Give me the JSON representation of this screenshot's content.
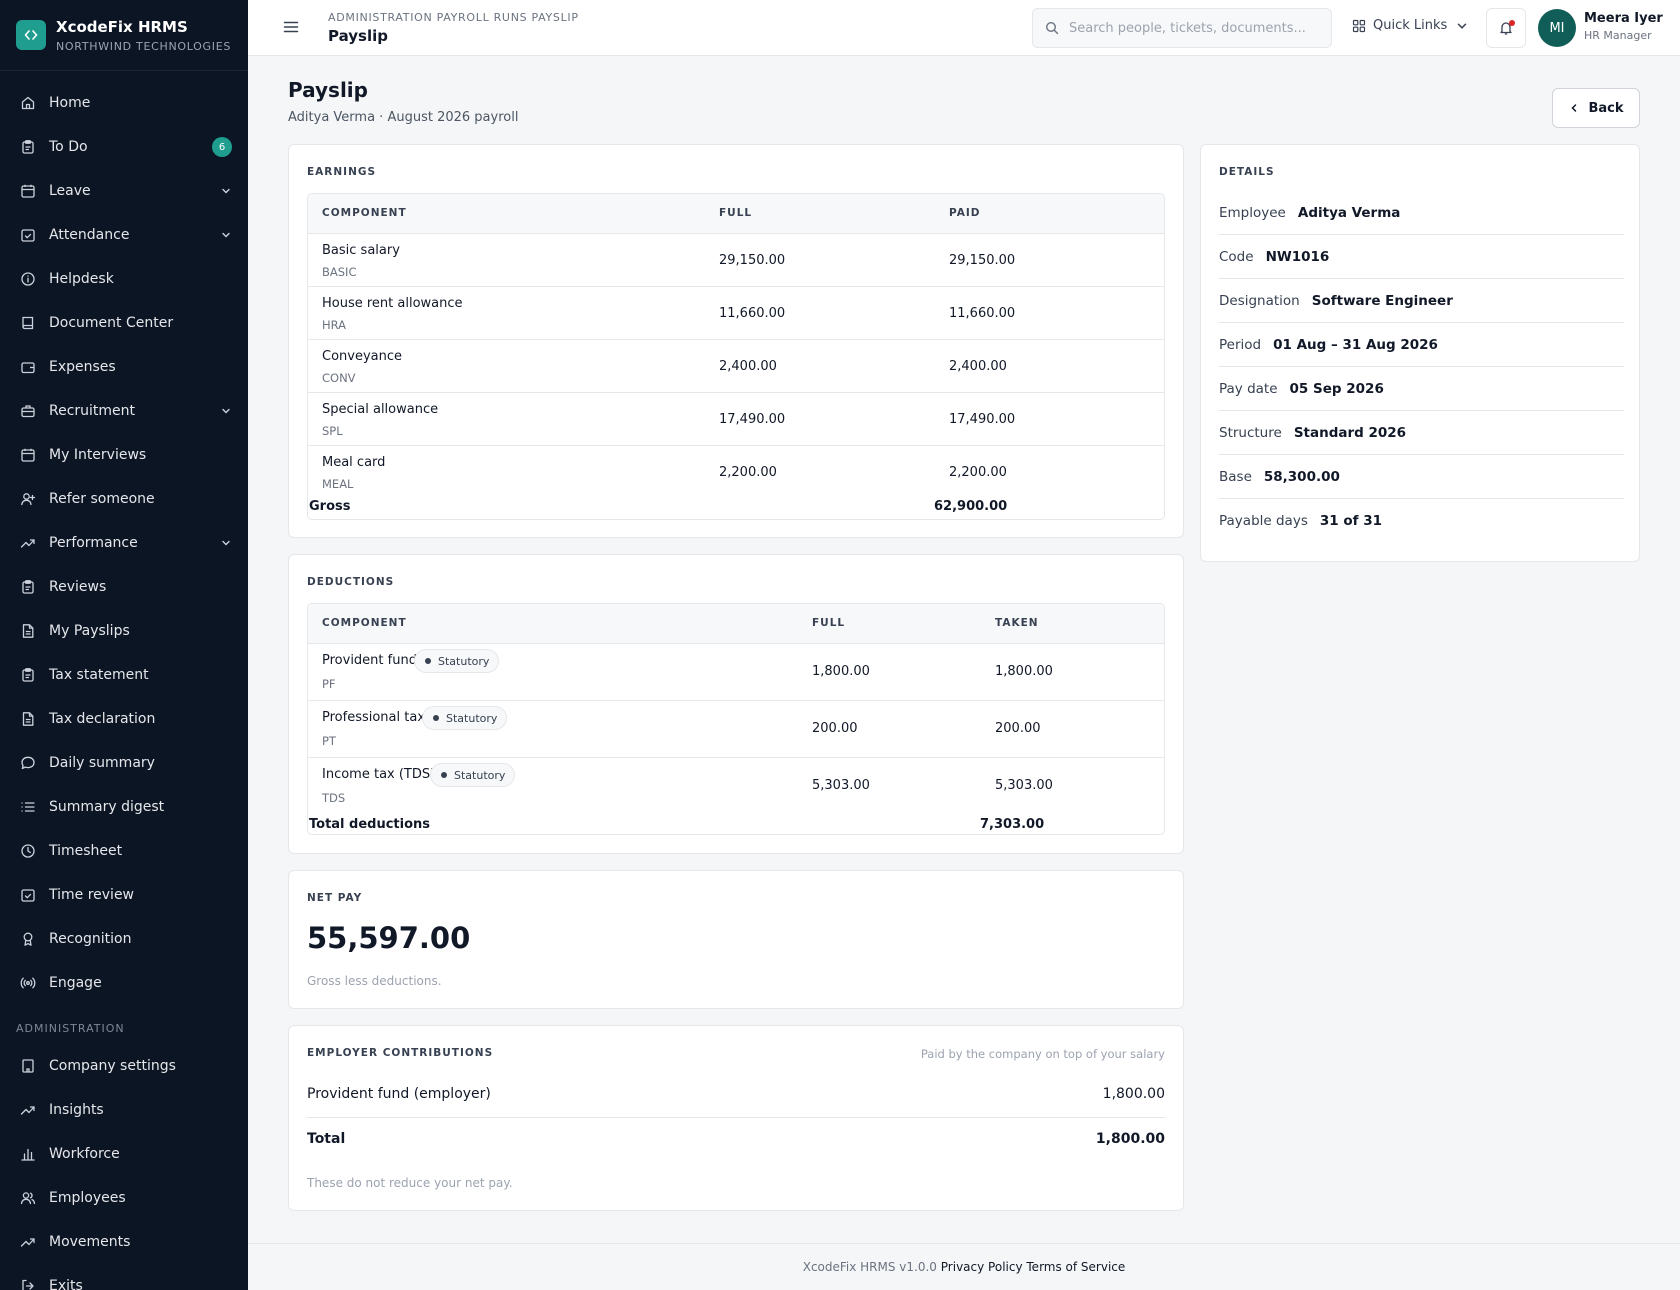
{
  "brand": {
    "name": "XcodeFix HRMS",
    "company": "NORTHWIND TECHNOLOGIES",
    "accent": "#1f9d8e",
    "sidebar_bg": "#0c1524"
  },
  "sidebar": {
    "items": [
      {
        "label": "Home",
        "icon": "home-icon"
      },
      {
        "label": "To Do",
        "icon": "clipboard-icon",
        "badge": "6"
      },
      {
        "label": "Leave",
        "icon": "calendar-icon",
        "chevron": true
      },
      {
        "label": "Attendance",
        "icon": "calendar-check-icon",
        "chevron": true
      },
      {
        "label": "Helpdesk",
        "icon": "info-icon"
      },
      {
        "label": "Document Center",
        "icon": "book-icon"
      },
      {
        "label": "Expenses",
        "icon": "wallet-icon"
      },
      {
        "label": "Recruitment",
        "icon": "briefcase-icon",
        "chevron": true
      },
      {
        "label": "My Interviews",
        "icon": "calendar-icon"
      },
      {
        "label": "Refer someone",
        "icon": "user-plus-icon"
      },
      {
        "label": "Performance",
        "icon": "trending-up-icon",
        "chevron": true
      },
      {
        "label": "Reviews",
        "icon": "clipboard-icon"
      },
      {
        "label": "My Payslips",
        "icon": "file-icon"
      },
      {
        "label": "Tax statement",
        "icon": "clipboard-icon"
      },
      {
        "label": "Tax declaration",
        "icon": "file-icon"
      },
      {
        "label": "Daily summary",
        "icon": "message-icon"
      },
      {
        "label": "Summary digest",
        "icon": "list-icon"
      },
      {
        "label": "Timesheet",
        "icon": "clock-icon"
      },
      {
        "label": "Time review",
        "icon": "calendar-check-icon"
      },
      {
        "label": "Recognition",
        "icon": "award-icon"
      },
      {
        "label": "Engage",
        "icon": "broadcast-icon"
      }
    ],
    "admin_section": "ADMINISTRATION",
    "admin_items": [
      {
        "label": "Company settings",
        "icon": "building-icon"
      },
      {
        "label": "Insights",
        "icon": "trending-up-icon"
      },
      {
        "label": "Workforce",
        "icon": "bar-chart-icon"
      },
      {
        "label": "Employees",
        "icon": "users-icon"
      },
      {
        "label": "Movements",
        "icon": "trending-up-icon"
      },
      {
        "label": "Exits",
        "icon": "log-out-icon"
      }
    ]
  },
  "topbar": {
    "breadcrumb": "ADMINISTRATION PAYROLL RUNS PAYSLIP",
    "title": "Payslip",
    "search_placeholder": "Search people, tickets, documents...",
    "quick_links": "Quick Links",
    "user": {
      "initials": "MI",
      "name": "Meera Iyer",
      "role": "HR Manager"
    }
  },
  "page": {
    "title": "Payslip",
    "subtitle": "Aditya Verma · August 2026 payroll",
    "back_label": "Back"
  },
  "earnings": {
    "title": "EARNINGS",
    "columns": [
      "COMPONENT",
      "FULL",
      "PAID"
    ],
    "rows": [
      {
        "name": "Basic salary",
        "code": "BASIC",
        "full": "29,150.00",
        "paid": "29,150.00"
      },
      {
        "name": "House rent allowance",
        "code": "HRA",
        "full": "11,660.00",
        "paid": "11,660.00"
      },
      {
        "name": "Conveyance",
        "code": "CONV",
        "full": "2,400.00",
        "paid": "2,400.00"
      },
      {
        "name": "Special allowance",
        "code": "SPL",
        "full": "17,490.00",
        "paid": "17,490.00"
      },
      {
        "name": "Meal card",
        "code": "MEAL",
        "full": "2,200.00",
        "paid": "2,200.00"
      }
    ],
    "total_label": "Gross",
    "total_value": "62,900.00"
  },
  "deductions": {
    "title": "DEDUCTIONS",
    "columns": [
      "COMPONENT",
      "FULL",
      "TAKEN"
    ],
    "rows": [
      {
        "name": "Provident fund",
        "tag": "Statutory",
        "code": "PF",
        "full": "1,800.00",
        "taken": "1,800.00"
      },
      {
        "name": "Professional tax",
        "tag": "Statutory",
        "code": "PT",
        "full": "200.00",
        "taken": "200.00"
      },
      {
        "name": "Income tax (TDS)",
        "tag": "Statutory",
        "code": "TDS",
        "full": "5,303.00",
        "taken": "5,303.00"
      }
    ],
    "total_label": "Total deductions",
    "total_value": "7,303.00"
  },
  "net_pay": {
    "title": "NET PAY",
    "amount": "55,597.00",
    "note": "Gross less deductions."
  },
  "employer_contributions": {
    "title": "EMPLOYER CONTRIBUTIONS",
    "hint": "Paid by the company on top of your salary",
    "rows": [
      {
        "label": "Provident fund (employer)",
        "value": "1,800.00"
      }
    ],
    "total_label": "Total",
    "total_value": "1,800.00",
    "note": "These do not reduce your net pay."
  },
  "details": {
    "title": "DETAILS",
    "rows": [
      {
        "label": "Employee",
        "value": "Aditya Verma"
      },
      {
        "label": "Code",
        "value": "NW1016"
      },
      {
        "label": "Designation",
        "value": "Software Engineer"
      },
      {
        "label": "Period",
        "value": "01 Aug – 31 Aug 2026"
      },
      {
        "label": "Pay date",
        "value": "05 Sep 2026"
      },
      {
        "label": "Structure",
        "value": "Standard 2026"
      },
      {
        "label": "Base",
        "value": "58,300.00"
      },
      {
        "label": "Payable days",
        "value": "31 of 31"
      }
    ]
  },
  "footer": {
    "version": "XcodeFix HRMS v1.0.0",
    "privacy": "Privacy Policy",
    "terms": "Terms of Service"
  }
}
